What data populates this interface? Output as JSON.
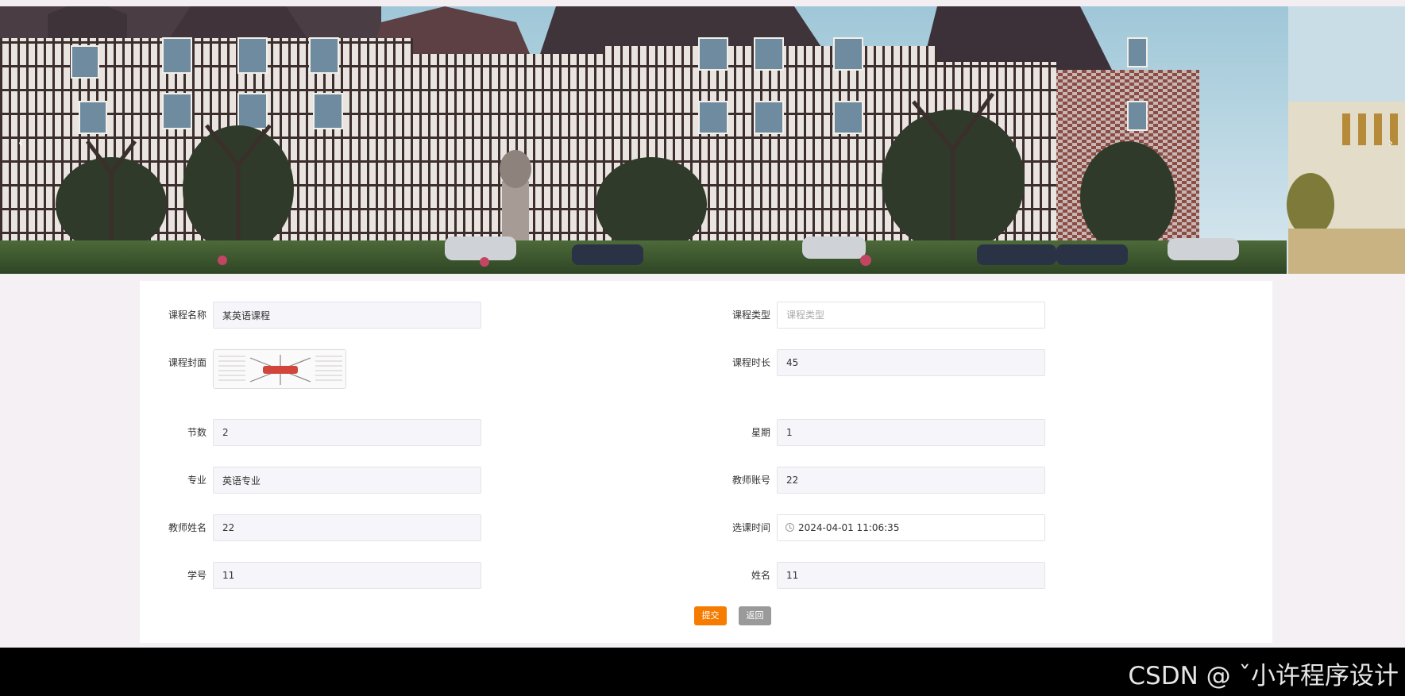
{
  "banner": {
    "prev_label": "‹",
    "next_label": "›"
  },
  "form": {
    "course_name": {
      "label": "课程名称",
      "value": "某英语课程"
    },
    "course_type": {
      "label": "课程类型",
      "placeholder": "课程类型",
      "value": ""
    },
    "course_cover": {
      "label": "课程封面"
    },
    "course_duration": {
      "label": "课程时长",
      "value": "45"
    },
    "sessions": {
      "label": "节数",
      "value": "2"
    },
    "weekday": {
      "label": "星期",
      "value": "1"
    },
    "major": {
      "label": "专业",
      "value": "英语专业"
    },
    "teacher_account": {
      "label": "教师账号",
      "value": "22"
    },
    "teacher_name": {
      "label": "教师姓名",
      "value": "22"
    },
    "select_time": {
      "label": "选课时间",
      "value": "2024-04-01 11:06:35"
    },
    "student_id": {
      "label": "学号",
      "value": "11"
    },
    "name": {
      "label": "姓名",
      "value": "11"
    }
  },
  "buttons": {
    "submit": "提交",
    "back": "返回"
  },
  "watermark": "CSDN @ ˇ小许程序设计",
  "colors": {
    "submit": "#f57c00",
    "back": "#9a9a9a",
    "input_bg": "#f6f5fa",
    "footer": "#000000"
  }
}
